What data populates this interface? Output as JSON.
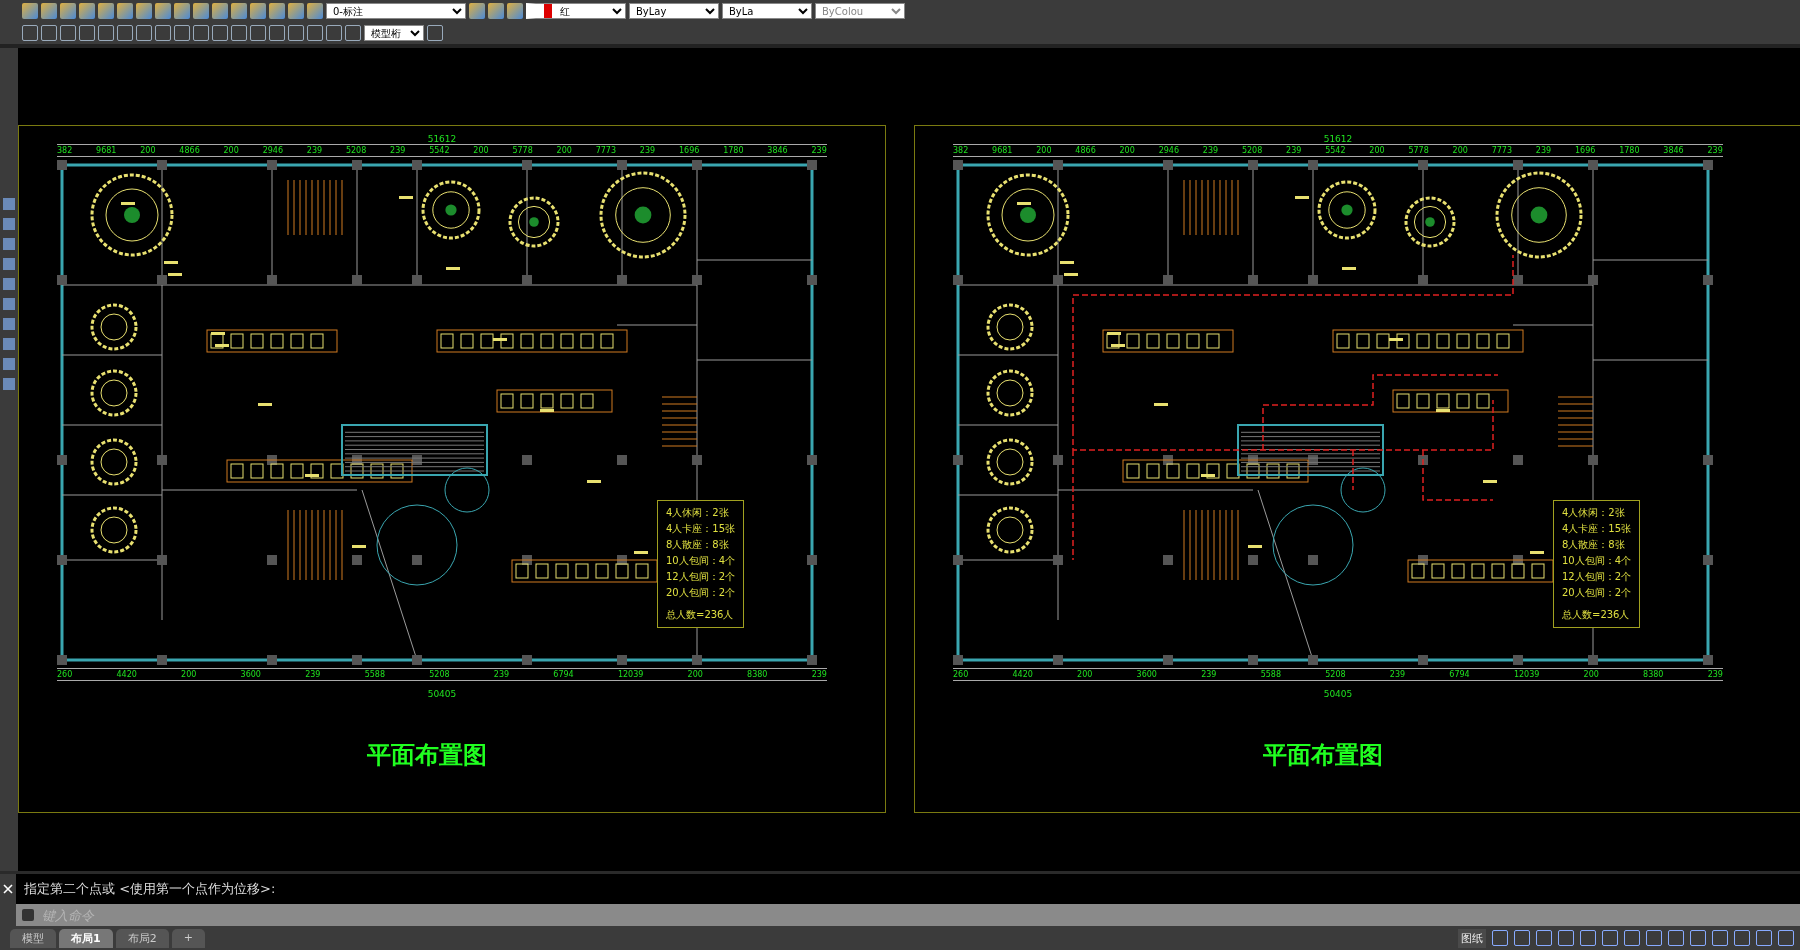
{
  "toolbar": {
    "layer": "0-标注",
    "layer_color": "红",
    "linetype": "ByLay",
    "lineweight": "ByLa",
    "plotstyle": "ByColou",
    "scale": "模型桁"
  },
  "panels": [
    {
      "route": false,
      "top_total": "51612",
      "top_dims": [
        "382",
        "9681",
        "200",
        "4866",
        "200",
        "2946",
        "239",
        "5208",
        "239",
        "5542",
        "200",
        "5778",
        "200",
        "7773",
        "239",
        "1696",
        "1780",
        "3846",
        "239"
      ],
      "bottom_dims": [
        "260",
        "4420",
        "200",
        "3600",
        "239",
        "5588",
        "5208",
        "239",
        "6794",
        "12039",
        "200",
        "8380",
        "239"
      ],
      "bottom_total": "50405",
      "legend": [
        "4人休闲：2张",
        "4人卡座：15张",
        "8人散座：8张",
        "10人包间：4个",
        "12人包间：2个",
        "20人包间：2个",
        "总人数=236人"
      ],
      "title": "平面布置图"
    },
    {
      "route": true,
      "top_total": "51612",
      "top_dims": [
        "382",
        "9681",
        "200",
        "4866",
        "200",
        "2946",
        "239",
        "5208",
        "239",
        "5542",
        "200",
        "5778",
        "200",
        "7773",
        "239",
        "1696",
        "1780",
        "3846",
        "239"
      ],
      "bottom_dims": [
        "260",
        "4420",
        "200",
        "3600",
        "239",
        "5588",
        "5208",
        "239",
        "6794",
        "12039",
        "200",
        "8380",
        "239"
      ],
      "bottom_total": "50405",
      "legend": [
        "4人休闲：2张",
        "4人卡座：15张",
        "8人散座：8张",
        "10人包间：4个",
        "12人包间：2个",
        "20人包间：2个",
        "总人数=236人"
      ],
      "title": "平面布置图"
    }
  ],
  "command": {
    "history": "指定第二个点或 <使用第一个点作为位移>:",
    "placeholder": "键入命令"
  },
  "tabs": [
    {
      "label": "模型",
      "selected": false
    },
    {
      "label": "布局1",
      "selected": true
    },
    {
      "label": "布局2",
      "selected": false
    },
    {
      "label": "+",
      "selected": false
    }
  ],
  "status": {
    "space": "图纸"
  }
}
